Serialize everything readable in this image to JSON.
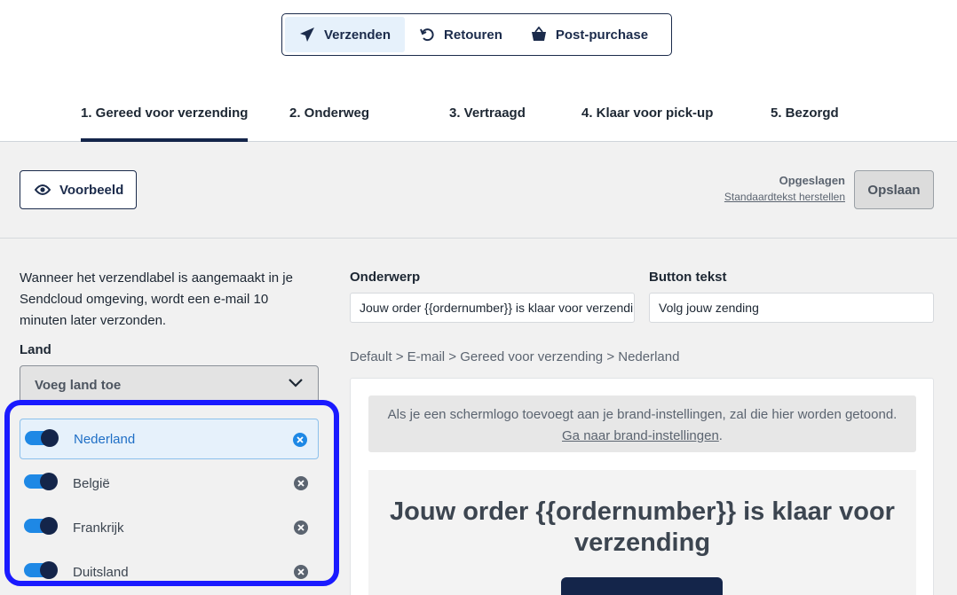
{
  "mode_tabs": [
    {
      "label": "Verzenden",
      "icon": "paper-plane-icon",
      "active": true
    },
    {
      "label": "Retouren",
      "icon": "undo-icon",
      "active": false
    },
    {
      "label": "Post-purchase",
      "icon": "basket-icon",
      "active": false
    }
  ],
  "steps": [
    {
      "label": "1. Gereed voor verzending",
      "active": true
    },
    {
      "label": "2. Onderweg",
      "active": false
    },
    {
      "label": "3. Vertraagd",
      "active": false
    },
    {
      "label": "4. Klaar voor pick-up",
      "active": false
    },
    {
      "label": "5. Bezorgd",
      "active": false
    }
  ],
  "toolbar": {
    "preview_label": "Voorbeeld",
    "saved_status": "Opgeslagen",
    "reset_link": "Standaardtekst herstellen",
    "save_label": "Opslaan"
  },
  "intro_text": "Wanneer het verzendlabel is aangemaakt in je Sendcloud omgeving, wordt een e-mail 10 minuten later verzonden.",
  "land": {
    "label": "Land",
    "select_placeholder": "Voeg land toe",
    "countries": [
      {
        "name": "Nederland",
        "enabled": true,
        "selected": true
      },
      {
        "name": "België",
        "enabled": true,
        "selected": false
      },
      {
        "name": "Frankrijk",
        "enabled": true,
        "selected": false
      },
      {
        "name": "Duitsland",
        "enabled": true,
        "selected": false
      }
    ]
  },
  "subject": {
    "label": "Onderwerp",
    "value": "Jouw order {{ordernumber}} is klaar voor verzending"
  },
  "button_text": {
    "label": "Button tekst",
    "value": "Volg jouw zending"
  },
  "breadcrumb": "Default > E-mail > Gereed voor verzending > Nederland",
  "preview": {
    "notice_text": "Als je een schermlogo toevoegt aan je brand-instellingen, zal die hier worden getoond.",
    "notice_link": "Ga naar brand-instellingen",
    "notice_end": ".",
    "email_heading": "Jouw order {{ordernumber}} is klaar voor verzending"
  },
  "colors": {
    "navy": "#14254a",
    "accent_blue": "#1e88e5",
    "highlight_border": "#1a1aff"
  }
}
